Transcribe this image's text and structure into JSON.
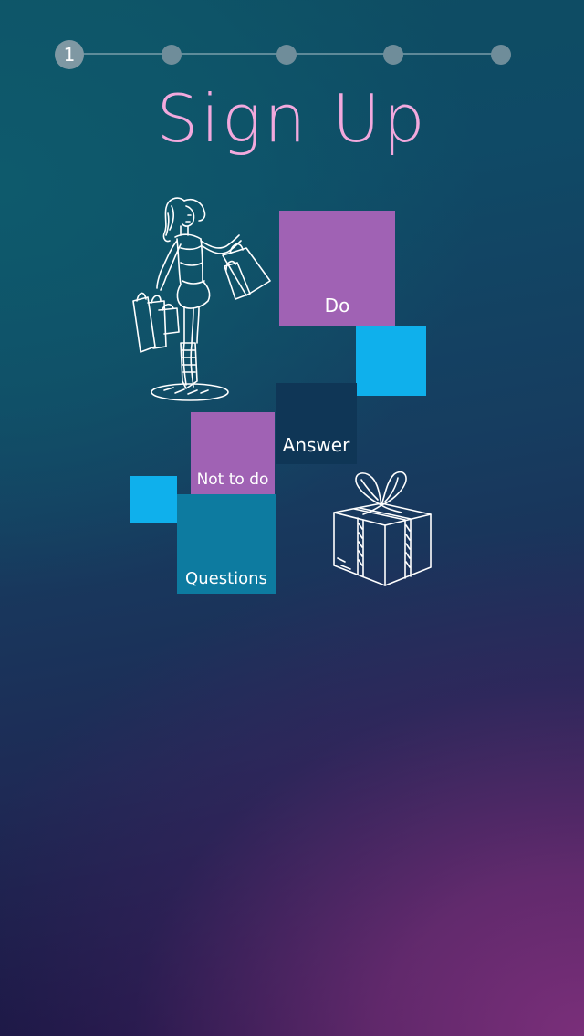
{
  "progress": {
    "current_step": "1",
    "total_steps": 5
  },
  "title": "Sign Up",
  "tiles": {
    "do": "Do",
    "answer": "Answer",
    "not_to_do": "Not to do",
    "questions": "Questions"
  },
  "colors": {
    "title_pink": "#f2a9dd",
    "tile_purple": "#a062b4",
    "tile_cyan": "#0fb0ec",
    "tile_navy": "#0f3656",
    "tile_teal": "#0d7ba0"
  },
  "illustrations": {
    "woman": "shopping-woman-sketch",
    "gift": "gift-box-sketch"
  }
}
